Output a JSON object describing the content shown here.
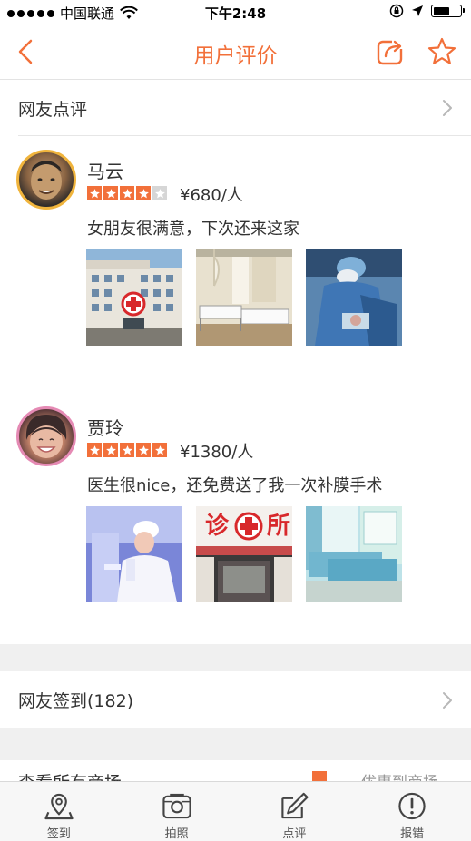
{
  "status": {
    "carrier": "中国联通",
    "time": "下午2:48"
  },
  "nav": {
    "title": "用户评价"
  },
  "sections": {
    "reviews_header": "网友点评",
    "checkin_header": "网友签到(182)",
    "more_left": "查看所有商场",
    "more_right": "优惠到商场"
  },
  "reviews": [
    {
      "name": "马云",
      "stars": 4,
      "max_stars": 5,
      "price": "¥680/人",
      "comment": "女朋友很满意，下次还来这家"
    },
    {
      "name": "贾玲",
      "stars": 5,
      "max_stars": 5,
      "price": "¥1380/人",
      "comment": "医生很nice，还免费送了我一次补膜手术"
    }
  ],
  "tabs": [
    {
      "label": "签到",
      "icon": "location-pin-icon"
    },
    {
      "label": "拍照",
      "icon": "camera-icon"
    },
    {
      "label": "点评",
      "icon": "edit-icon"
    },
    {
      "label": "报错",
      "icon": "power-alert-icon"
    }
  ],
  "colors": {
    "accent": "#f2703a",
    "star_empty": "#d6d6d6",
    "band": "#f0f0f0"
  }
}
